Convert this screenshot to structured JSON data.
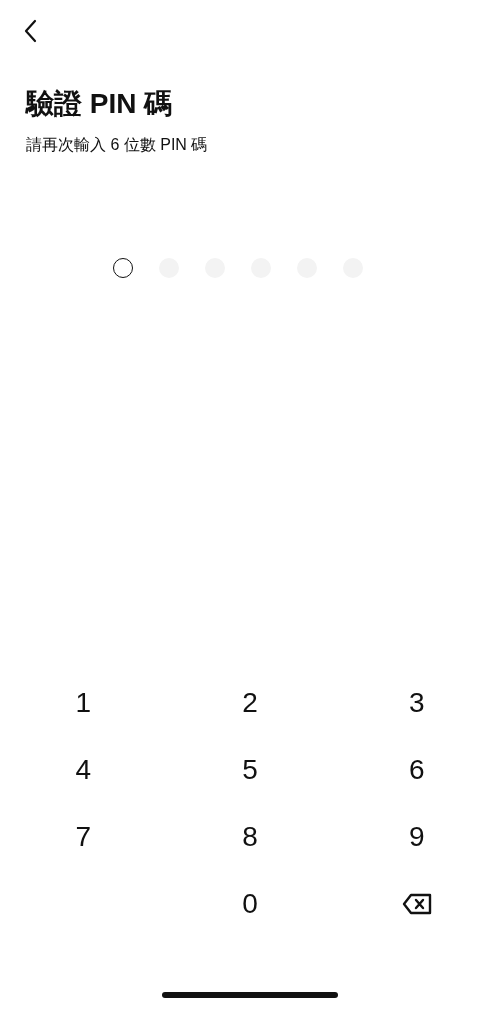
{
  "title": "驗證 PIN 碼",
  "subtitle": "請再次輸入 6 位數 PIN 碼",
  "pin_dots": [
    {
      "current": true
    },
    {
      "current": false
    },
    {
      "current": false
    },
    {
      "current": false
    },
    {
      "current": false
    },
    {
      "current": false
    }
  ],
  "keypad": [
    {
      "kind": "digit",
      "label": "1"
    },
    {
      "kind": "digit",
      "label": "2"
    },
    {
      "kind": "digit",
      "label": "3"
    },
    {
      "kind": "digit",
      "label": "4"
    },
    {
      "kind": "digit",
      "label": "5"
    },
    {
      "kind": "digit",
      "label": "6"
    },
    {
      "kind": "digit",
      "label": "7"
    },
    {
      "kind": "digit",
      "label": "8"
    },
    {
      "kind": "digit",
      "label": "9"
    },
    {
      "kind": "blank"
    },
    {
      "kind": "digit",
      "label": "0"
    },
    {
      "kind": "backspace"
    }
  ]
}
